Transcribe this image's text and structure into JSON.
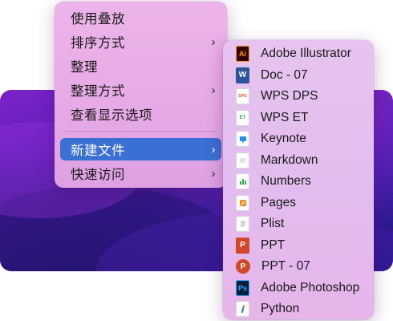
{
  "main_menu": {
    "items": [
      {
        "label": "使用叠放",
        "submenu": false
      },
      {
        "label": "排序方式",
        "submenu": true
      },
      {
        "label": "整理",
        "submenu": false
      },
      {
        "label": "整理方式",
        "submenu": true
      },
      {
        "label": "查看显示选项",
        "submenu": false
      },
      {
        "label": "新建文件",
        "submenu": true,
        "active": true
      },
      {
        "label": "快速访问",
        "submenu": true
      }
    ],
    "chevron": "›"
  },
  "sub_menu": {
    "items": [
      {
        "label": "Adobe Illustrator",
        "icon": "illustrator-icon",
        "glyph": "Ai"
      },
      {
        "label": "Doc - 07",
        "icon": "word-icon",
        "glyph": "W"
      },
      {
        "label": "WPS DPS",
        "icon": "wps-dps-icon",
        "glyph": "DPS"
      },
      {
        "label": "WPS ET",
        "icon": "wps-et-icon",
        "glyph": "ET"
      },
      {
        "label": "Keynote",
        "icon": "keynote-icon",
        "glyph": ""
      },
      {
        "label": "Markdown",
        "icon": "markdown-icon",
        "glyph": ""
      },
      {
        "label": "Numbers",
        "icon": "numbers-icon",
        "glyph": ""
      },
      {
        "label": "Pages",
        "icon": "pages-icon",
        "glyph": ""
      },
      {
        "label": "Plist",
        "icon": "plist-icon",
        "glyph": ""
      },
      {
        "label": "PPT",
        "icon": "powerpoint-icon",
        "glyph": "P"
      },
      {
        "label": "PPT - 07",
        "icon": "powerpoint-07-icon",
        "glyph": "P"
      },
      {
        "label": "Adobe Photoshop",
        "icon": "photoshop-icon",
        "glyph": "Ps"
      },
      {
        "label": "Python",
        "icon": "python-icon",
        "glyph": ""
      }
    ]
  },
  "colors": {
    "highlight": "#3a6fd3",
    "illustrator": "#330000",
    "illustrator_text": "#ff9a00",
    "word": "#2b579a",
    "powerpoint": "#d24726",
    "photoshop": "#001e36",
    "photoshop_text": "#31a8ff",
    "keynote": "#1f8ef1",
    "numbers": "#30b34a",
    "pages": "#f78b2a",
    "python": "#3776ab"
  }
}
